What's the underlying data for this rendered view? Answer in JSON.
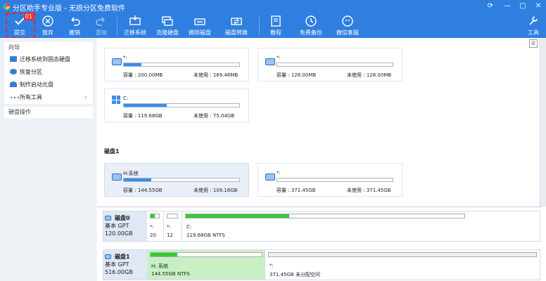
{
  "window": {
    "title": "分区助手专业版 - 无损分区免费软件",
    "controls": [
      "⟳",
      "—",
      "□",
      "✕"
    ]
  },
  "toolbar": {
    "badge": "01",
    "buttons": [
      {
        "label": "提交",
        "icon": "check-icon"
      },
      {
        "label": "放弃",
        "icon": "discard-icon"
      },
      {
        "label": "撤销",
        "icon": "undo-icon"
      },
      {
        "label": "重做",
        "icon": "redo-icon"
      },
      {
        "label": "迁移系统",
        "icon": "migrate-icon"
      },
      {
        "label": "克隆硬盘",
        "icon": "clone-icon"
      },
      {
        "label": "擦除磁盘",
        "icon": "wipe-icon"
      },
      {
        "label": "磁盘转换",
        "icon": "convert-icon"
      },
      {
        "label": "教程",
        "icon": "book-icon"
      },
      {
        "label": "免费备份",
        "icon": "backup-icon"
      },
      {
        "label": "微信客服",
        "icon": "wechat-icon"
      },
      {
        "label": "工具",
        "icon": "tools-icon"
      }
    ]
  },
  "sidebar": {
    "wizard_header": "向导",
    "items": [
      {
        "label": "迁移系统到固态硬盘",
        "icon": "migrate-icon"
      },
      {
        "label": "恢复分区",
        "icon": "recover-icon"
      },
      {
        "label": "制作启动光盘",
        "icon": "boot-disc-icon"
      },
      {
        "label": "所有工具",
        "icon": "more-icon",
        "arrow": "›"
      }
    ],
    "disk_ops_header": "硬盘操作"
  },
  "labels": {
    "cap": "容量 :",
    "free": "未使用 :"
  },
  "cards": [
    {
      "name": "*:",
      "capacity": "200.00MB",
      "free": "169.46MB",
      "used": 0.15
    },
    {
      "name": "*:",
      "capacity": "128.00MB",
      "free": "128.00MB",
      "used": 0.0
    },
    {
      "name": "C:",
      "capacity": "119.68GB",
      "free": "75.04GB",
      "used": 0.37
    },
    {
      "name": "H:系统",
      "capacity": "144.55GB",
      "free": "109.16GB",
      "used": 0.24
    },
    {
      "name": "*:",
      "capacity": "371.45GB",
      "free": "371.45GB",
      "used": 0.0
    }
  ],
  "disk1_label": "磁盘1",
  "disks": [
    {
      "name": "磁盘0",
      "type": "基本 GPT",
      "size": "120.00GB",
      "parts": [
        {
          "label": "*:",
          "size": "20",
          "used": 0.5
        },
        {
          "label": "*:",
          "size": "12",
          "used": 0.0
        },
        {
          "label": "C:",
          "size": "119.68GB NTFS",
          "used": 0.37
        }
      ]
    },
    {
      "name": "磁盘1",
      "type": "基本 GPT",
      "size": "516.00GB",
      "parts": [
        {
          "label": "H: 系统",
          "size": "144.55GB NTFS",
          "used": 0.24
        },
        {
          "label": "*:",
          "size": "371.45GB 未分配空间",
          "used": 0.0
        }
      ]
    }
  ],
  "colors": {
    "accent": "#2f7fe0",
    "selected_part": "#c8f0c4",
    "used_fill": "#3a8ee8",
    "disk_fill": "#33cc33"
  }
}
